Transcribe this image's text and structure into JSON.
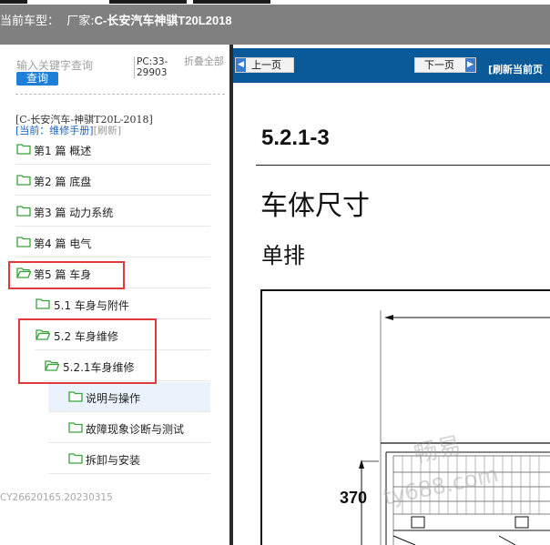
{
  "header": {
    "label": "当前车型：",
    "manufacturer_label": "厂家:",
    "model": "C-长安汽车神骐T20L2018"
  },
  "search": {
    "placeholder": "输入关键字查询",
    "button": "查询"
  },
  "pc_code": "PC:33-29903",
  "fold_all": "折叠全部",
  "tree": {
    "root": "[C-长安汽车-神骐T20L-2018]",
    "current": "[当前：维修手册]",
    "refresh": "[刷新]",
    "items": [
      {
        "label": "第1 篇 概述"
      },
      {
        "label": "第2 篇 底盘"
      },
      {
        "label": "第3 篇 动力系统"
      },
      {
        "label": "第4 篇 电气"
      },
      {
        "label": "第5 篇 车身"
      },
      {
        "label": "5.1 车身与附件"
      },
      {
        "label": "5.2 车身维修"
      },
      {
        "label": "5.2.1车身维修"
      },
      {
        "label": "说明与操作"
      },
      {
        "label": "故障现象诊断与测试"
      },
      {
        "label": "拆卸与安装"
      }
    ]
  },
  "footer_id": "CY26620165.20230315",
  "toolbar": {
    "prev": "上一页",
    "next": "下一页",
    "refresh_page": "[刷新当前页"
  },
  "document": {
    "section": "5.2.1-3",
    "title": "车体尺寸",
    "subtitle": "单排",
    "dimension": "370"
  },
  "watermark": {
    "text1": "畅易",
    "text2": "ty688.com"
  },
  "colors": {
    "header_bg": "#808080",
    "toolbar_bg": "#0a5a9a",
    "highlight": "#e03a3a",
    "search_btn": "#1f7fd6",
    "folder": "#3aa13a"
  }
}
